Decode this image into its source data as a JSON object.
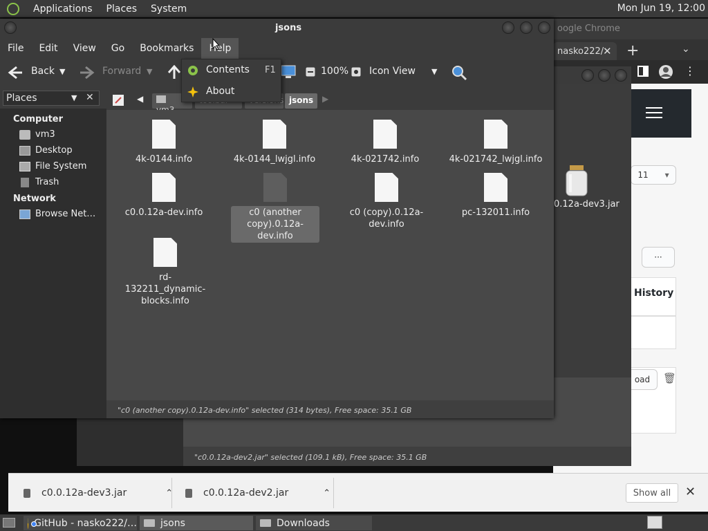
{
  "top_panel": {
    "menus": [
      "Applications",
      "Places",
      "System"
    ],
    "clock": "Mon Jun 19, 12:00"
  },
  "chrome": {
    "title": "oogle Chrome",
    "tab_label": "nasko222/",
    "tab_close": "✕",
    "new_tab": "+",
    "dropdown": "⌄",
    "history_label": "History",
    "more_button": "···",
    "version_snippet": "11",
    "load_button": "oad"
  },
  "caja2": {
    "jar_label": "0.12a-dev3.jar",
    "status": "\"c0.0.12a-dev2.jar\" selected (109.1 kB), Free space: 35.1 GB"
  },
  "caja": {
    "title": "jsons",
    "menubar": [
      "File",
      "Edit",
      "View",
      "Go",
      "Bookmarks",
      "Help"
    ],
    "toolbar": {
      "back": "Back",
      "forward": "Forward",
      "zoom": "100%",
      "view_mode": "Icon View"
    },
    "sidebar_header": "Places",
    "sidebar_close": "✕",
    "sidebar": {
      "computer_heading": "Computer",
      "network_heading": "Network",
      "computer_items": [
        "vm3",
        "Desktop",
        "File System",
        "Trash"
      ],
      "network_items": [
        "Browse Net…"
      ]
    },
    "breadcrumbs": [
      "vm3",
      "toolbar",
      "versions",
      "jsons"
    ],
    "files": [
      {
        "name": "4k-0144.info"
      },
      {
        "name": "4k-0144_lwjgl.info"
      },
      {
        "name": "4k-021742.info"
      },
      {
        "name": "4k-021742_lwjgl.info"
      },
      {
        "name": "c0.0.12a-dev.info"
      },
      {
        "name": "c0 (another copy).0.12a-dev.info"
      },
      {
        "name": "c0 (copy).0.12a-dev.info"
      },
      {
        "name": "pc-132011.info"
      },
      {
        "name": "rd-132211_dynamic-blocks.info"
      }
    ],
    "status": "\"c0 (another copy).0.12a-dev.info\" selected (314 bytes), Free space: 35.1 GB"
  },
  "help_menu": {
    "items": [
      {
        "label": "Contents",
        "shortcut": "F1"
      },
      {
        "label": "About",
        "shortcut": ""
      }
    ]
  },
  "downloads": {
    "items": [
      "c0.0.12a-dev3.jar",
      "c0.0.12a-dev2.jar"
    ],
    "show_all": "Show all",
    "close": "✕"
  },
  "taskbar": {
    "tasks": [
      "GitHub - nasko222/…",
      "jsons",
      "Downloads"
    ]
  }
}
